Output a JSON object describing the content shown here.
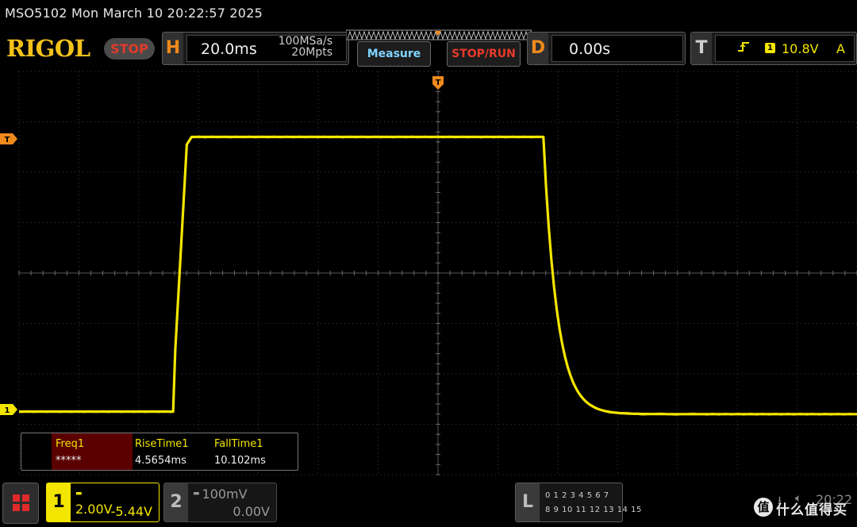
{
  "title_bar": {
    "text": "MSO5102  Mon March 10 20:22:57 2025"
  },
  "toolbar": {
    "brand": "RIGOL",
    "run_state": "STOP",
    "horizontal": {
      "letter": "H",
      "timebase": "20.0ms",
      "sample_rate": "100MSa/s",
      "memory_depth": "20Mpts"
    },
    "measure_label": "Measure",
    "stop_run_label": "STOP/RUN",
    "delay": {
      "letter": "D",
      "value": "0.00s"
    },
    "trigger": {
      "letter": "T",
      "source": "1",
      "level": "10.8V",
      "mode": "A",
      "edge_icon": "rising-edge-icon"
    }
  },
  "markers": {
    "trigger_level": "T",
    "channel1_ground": "1",
    "trigger_position": "T"
  },
  "measurements": [
    {
      "label": "Freq1",
      "value": "*****"
    },
    {
      "label": "RiseTime1",
      "value": "4.5654ms"
    },
    {
      "label": "FallTime1",
      "value": "10.102ms"
    }
  ],
  "channels": {
    "ch1": {
      "number": "1",
      "scale": "2.00V",
      "offset": "-5.44V",
      "coupling": "dc-coupling-icon"
    },
    "ch2": {
      "number": "2",
      "scale": "100mV",
      "offset": "0.00V",
      "coupling": "dc-coupling-icon"
    }
  },
  "logic_analyzer": {
    "letter": "L",
    "row1": "0 1 2 3  4 5 6 7",
    "row2": "8 9 10 11 12 13 14 15"
  },
  "status": {
    "clock": "20:22",
    "usb_icon": "usb-icon",
    "speaker_icon": "speaker-icon"
  },
  "watermark": {
    "badge": "值",
    "text": "什么值得买"
  },
  "colors": {
    "trace": "#f3e500",
    "accent_orange": "#f08a1c",
    "stop_red": "#e23a2a",
    "measure_blue": "#7fd4ff"
  },
  "waveform": {
    "channel": "1",
    "volts_per_div": 2.0,
    "seconds_per_div": 0.02,
    "low_level_div": -2.75,
    "high_level_div": 2.7,
    "rise_time_ms": 4.5654,
    "fall_time_ms": 10.102
  }
}
